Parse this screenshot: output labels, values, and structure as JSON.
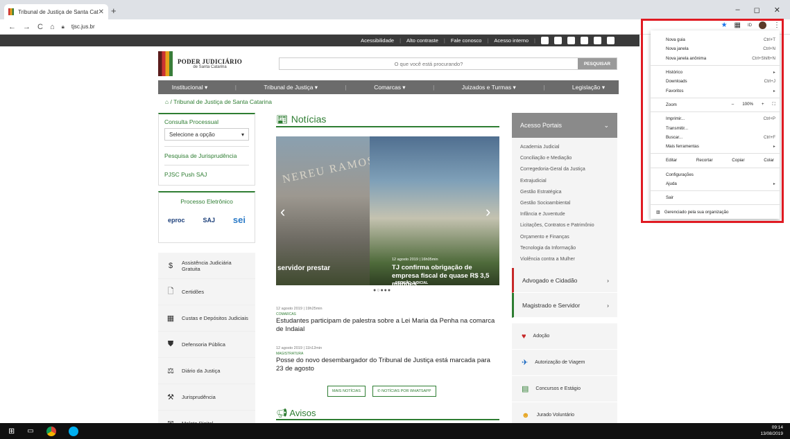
{
  "browser": {
    "tab_title": "Tribunal de Justiça de Santa Catar",
    "url": "tjsc.jus.br"
  },
  "topbar": {
    "items": [
      "Acessibilidade",
      "Alto contraste",
      "Fale conosco",
      "Acesso interno"
    ]
  },
  "logo": {
    "line1": "PODER JUDICIÁRIO",
    "line2": "de Santa Catarina"
  },
  "search": {
    "placeholder": "O que você está procurando?",
    "button": "PESQUISAR"
  },
  "nav": [
    "Institucional ▾",
    "Tribunal de Justiça ▾",
    "Comarcas ▾",
    "Juizados e Turmas ▾",
    "Legislação ▾"
  ],
  "breadcrumb": "Tribunal de Justiça de Santa Catarina",
  "left": {
    "consulta": "Consulta Processual",
    "select": "Selecione a opção",
    "jurisprudencia": "Pesquisa de Jurisprudência",
    "push": "PJSC Push SAJ",
    "pe_title": "Processo Eletrônico",
    "logos": [
      "eproc",
      "SAJ",
      "sei"
    ],
    "services": [
      "Assistência Judiciária Gratuita",
      "Certidões",
      "Custas e Depósitos Judiciais",
      "Defensoria Pública",
      "Diário da Justiça",
      "Jurisprudência",
      "Malote Digital"
    ]
  },
  "news": {
    "header": "Notícias",
    "slide1_caption": "servidor prestar",
    "slide2_tag": "DECISÃO JUDICIAL",
    "slide2_date": "12 agosto 2019 | 16h05min",
    "slide2_caption": "TJ confirma obrigação de empresa fiscal de quase R$ 3,5 milhões",
    "slide2_sign": "NEREU RAMOS",
    "items": [
      {
        "date": "12 agosto 2019 | 19h25min",
        "cat": "COMARCAS",
        "title": "Estudantes participam de palestra sobre a Lei Maria da Penha na comarca de Indaial"
      },
      {
        "date": "12 agosto 2019 | 11h12min",
        "cat": "MAGISTRATURA",
        "title": "Posse do novo desembargador do Tribunal de Justiça está marcada para 23 de agosto"
      }
    ],
    "btn_more": "MAIS NOTÍCIAS",
    "btn_whatsapp": "NOTÍCIAS POR WHATSAPP",
    "avisos": "Avisos"
  },
  "right": {
    "header": "Acesso Portais",
    "portals": [
      "Academia Judicial",
      "Conciliação e Mediação",
      "Corregedoria-Geral da Justiça",
      "Extrajudicial",
      "Gestão Estratégica",
      "Gestão Socioambiental",
      "Infância e Juventude",
      "Licitações, Contratos e Patrimônio",
      "Orçamento e Finanças",
      "Tecnologia da Informação",
      "Violência contra a Mulher"
    ],
    "cat1": "Advogado e Cidadão",
    "cat2": "Magistrado e Servidor",
    "services": [
      "Adoção",
      "Autorização de Viagem",
      "Concursos e Estágio",
      "Jurado Voluntário"
    ]
  },
  "menu": {
    "g1": [
      [
        "Nova guia",
        "Ctrl+T"
      ],
      [
        "Nova janela",
        "Ctrl+N"
      ],
      [
        "Nova janela anônima",
        "Ctrl+Shift+N"
      ]
    ],
    "g2": [
      [
        "Histórico",
        "▸"
      ],
      [
        "Downloads",
        "Ctrl+J"
      ],
      [
        "Favoritos",
        "▸"
      ]
    ],
    "zoom_label": "Zoom",
    "zoom_value": "100%",
    "g3": [
      [
        "Imprimir...",
        "Ctrl+P"
      ],
      [
        "Transmitir...",
        ""
      ],
      [
        "Buscar...",
        "Ctrl+F"
      ],
      [
        "Mais ferramentas",
        "▸"
      ]
    ],
    "edit": [
      "Editar",
      "Recortar",
      "Copiar",
      "Colar"
    ],
    "g4": [
      [
        "Configurações",
        ""
      ],
      [
        "Ajuda",
        "▸"
      ]
    ],
    "sair": "Sair",
    "managed": "Gerenciado pela sua organização"
  },
  "clock": {
    "time": "09:14",
    "date": "13/08/2019"
  }
}
